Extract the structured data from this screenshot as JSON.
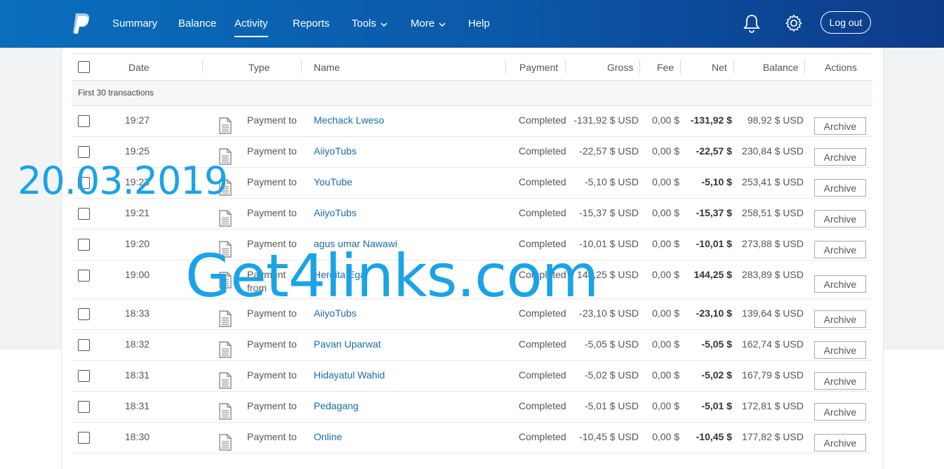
{
  "nav": {
    "items": [
      {
        "label": "Summary"
      },
      {
        "label": "Balance"
      },
      {
        "label": "Activity"
      },
      {
        "label": "Reports"
      },
      {
        "label": "Tools"
      },
      {
        "label": "More"
      },
      {
        "label": "Help"
      }
    ],
    "active": "Activity",
    "logout_label": "Log out",
    "icons": [
      "paypal-logo",
      "bell-icon",
      "gear-icon"
    ]
  },
  "table": {
    "headers": {
      "date": "Date",
      "type": "Type",
      "name": "Name",
      "payment": "Payment",
      "gross": "Gross",
      "fee": "Fee",
      "net": "Net",
      "balance": "Balance",
      "actions": "Actions"
    },
    "section_label": "First 30 transactions",
    "archive_label": "Archive",
    "rows": [
      {
        "time": "19:27",
        "type": "Payment to",
        "name": "Mechack Lweso",
        "status": "Completed",
        "gross": "-131,92 $ USD",
        "fee": "0,00 $",
        "net": "-131,92 $",
        "balance": "98,92 $ USD"
      },
      {
        "time": "19:25",
        "type": "Payment to",
        "name": "AiiyoTubs",
        "status": "Completed",
        "gross": "-22,57 $ USD",
        "fee": "0,00 $",
        "net": "-22,57 $",
        "balance": "230,84 $ USD"
      },
      {
        "time": "19:23",
        "type": "Payment to",
        "name": "YouTube",
        "status": "Completed",
        "gross": "-5,10 $ USD",
        "fee": "0,00 $",
        "net": "-5,10 $",
        "balance": "253,41 $ USD"
      },
      {
        "time": "19:21",
        "type": "Payment to",
        "name": "AiiyoTubs",
        "status": "Completed",
        "gross": "-15,37 $ USD",
        "fee": "0,00 $",
        "net": "-15,37 $",
        "balance": "258,51 $ USD"
      },
      {
        "time": "19:20",
        "type": "Payment to",
        "name": "agus umar Nawawi",
        "status": "Completed",
        "gross": "-10,01 $ USD",
        "fee": "0,00 $",
        "net": "-10,01 $",
        "balance": "273,88 $ USD"
      },
      {
        "time": "19:00",
        "type": "Payment",
        "type2": "from",
        "name": "Herdita Ega",
        "status": "Completed",
        "gross": "144,25 $ USD",
        "fee": "0,00 $",
        "net": "144,25 $",
        "balance": "283,89 $ USD"
      },
      {
        "time": "18:33",
        "type": "Payment to",
        "name": "AiiyoTubs",
        "status": "Completed",
        "gross": "-23,10 $ USD",
        "fee": "0,00 $",
        "net": "-23,10 $",
        "balance": "139,64 $ USD"
      },
      {
        "time": "18:32",
        "type": "Payment to",
        "name": "Pavan Uparwat",
        "status": "Completed",
        "gross": "-5,05 $ USD",
        "fee": "0,00 $",
        "net": "-5,05 $",
        "balance": "162,74 $ USD"
      },
      {
        "time": "18:31",
        "type": "Payment to",
        "name": "Hidayatul Wahid",
        "status": "Completed",
        "gross": "-5,02 $ USD",
        "fee": "0,00 $",
        "net": "-5,02 $",
        "balance": "167,79 $ USD"
      },
      {
        "time": "18:31",
        "type": "Payment to",
        "name": "Pedagang",
        "status": "Completed",
        "gross": "-5,01 $ USD",
        "fee": "0,00 $",
        "net": "-5,01 $",
        "balance": "172,81 $ USD"
      },
      {
        "time": "18:30",
        "type": "Payment to",
        "name": "Online",
        "status": "Completed",
        "gross": "-10,45 $ USD",
        "fee": "0,00 $",
        "net": "-10,45 $",
        "balance": "177,82 $ USD"
      }
    ]
  },
  "watermarks": {
    "date": "20.03.2019",
    "site": "Get4links.com"
  },
  "colors": {
    "nav_start": "#0a6ebd",
    "nav_end": "#0e3a8a",
    "link": "#1b6aa5",
    "watermark": "#1aa3e8"
  }
}
